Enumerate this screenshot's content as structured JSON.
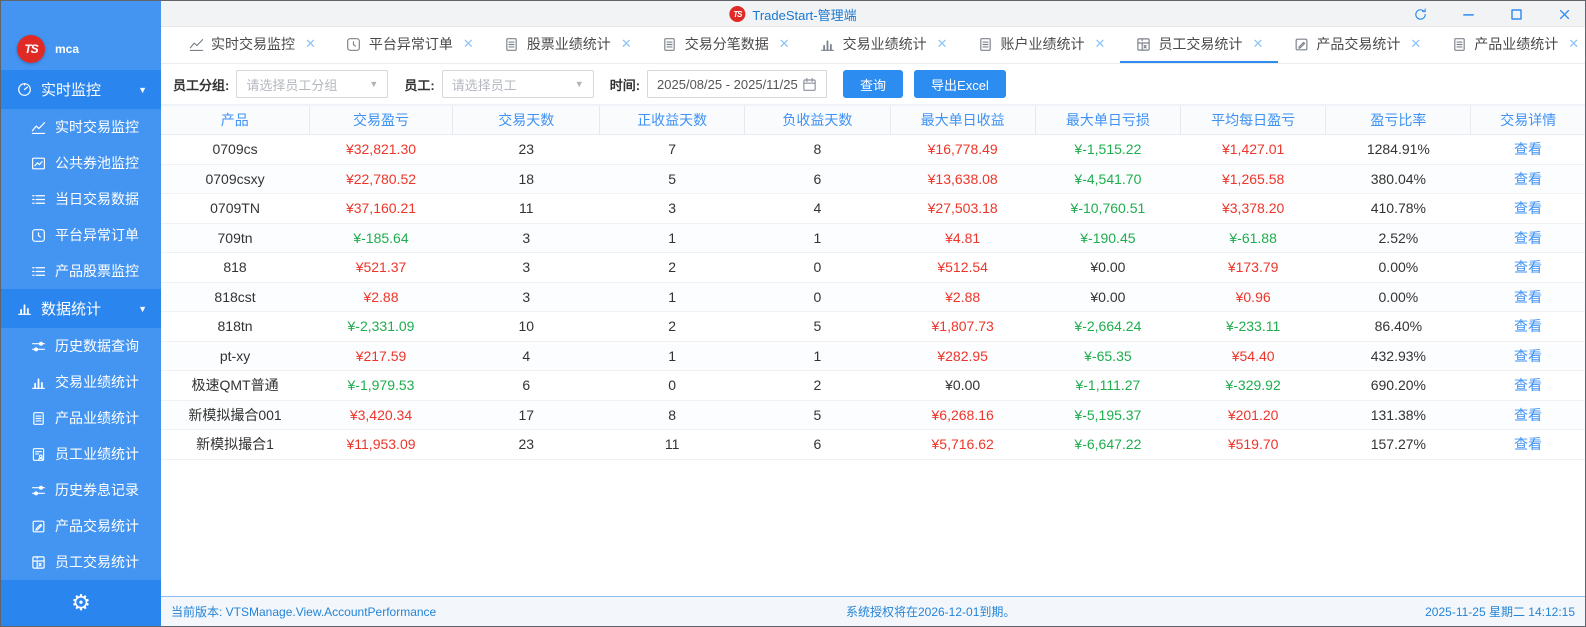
{
  "window": {
    "title": "TradeStart-管理端",
    "logo_text": "mca"
  },
  "titlebar": {
    "controls": [
      {
        "name": "refresh-button",
        "icon": "refresh-icon"
      },
      {
        "name": "minimize-button",
        "icon": "minimize-icon"
      },
      {
        "name": "maximize-button",
        "icon": "maximize-icon"
      },
      {
        "name": "close-button",
        "icon": "close-icon"
      }
    ]
  },
  "sidebar": {
    "groups": [
      {
        "label": "实时监控",
        "icon": "gauge-icon",
        "caret": "▼",
        "items": [
          {
            "label": "实时交易监控",
            "icon": "line-chart-icon"
          },
          {
            "label": "公共券池监控",
            "icon": "trend-box-icon"
          },
          {
            "label": "当日交易数据",
            "icon": "list-icon"
          },
          {
            "label": "平台异常订单",
            "icon": "clock-icon"
          },
          {
            "label": "产品股票监控",
            "icon": "list-icon"
          }
        ]
      },
      {
        "label": "数据统计",
        "icon": "bar-chart-icon",
        "caret": "▼",
        "items": [
          {
            "label": "历史数据查询",
            "icon": "sliders-icon"
          },
          {
            "label": "交易业绩统计",
            "icon": "bar-chart-icon"
          },
          {
            "label": "产品业绩统计",
            "icon": "doc-icon"
          },
          {
            "label": "员工业绩统计",
            "icon": "doc-person-icon"
          },
          {
            "label": "历史券息记录",
            "icon": "sliders-icon"
          },
          {
            "label": "产品交易统计",
            "icon": "edit-doc-icon"
          },
          {
            "label": "员工交易统计",
            "icon": "grid-doc-icon"
          }
        ]
      }
    ],
    "settings_icon": "gear-icon"
  },
  "tabs": [
    {
      "label": "实时交易监控",
      "icon": "line-chart-icon",
      "active": false
    },
    {
      "label": "平台异常订单",
      "icon": "clock-icon",
      "active": false
    },
    {
      "label": "股票业绩统计",
      "icon": "doc-icon",
      "active": false
    },
    {
      "label": "交易分笔数据",
      "icon": "doc-icon",
      "active": false
    },
    {
      "label": "交易业绩统计",
      "icon": "bar-chart-icon",
      "active": false
    },
    {
      "label": "账户业绩统计",
      "icon": "doc-icon",
      "active": false
    },
    {
      "label": "员工交易统计",
      "icon": "grid-doc-icon",
      "active": true
    },
    {
      "label": "产品交易统计",
      "icon": "edit-doc-icon",
      "active": false
    },
    {
      "label": "产品业绩统计",
      "icon": "doc-icon",
      "active": false
    }
  ],
  "filters": {
    "group_label": "员工分组:",
    "group_placeholder": "请选择员工分组",
    "employee_label": "员工:",
    "employee_placeholder": "请选择员工",
    "time_label": "时间:",
    "time_value": "2025/08/25 - 2025/11/25",
    "query_button": "查询",
    "export_button": "导出Excel"
  },
  "table": {
    "columns": [
      "产品",
      "交易盈亏",
      "交易天数",
      "正收益天数",
      "负收益天数",
      "最大单日收益",
      "最大单日亏损",
      "平均每日盈亏",
      "盈亏比率",
      "交易详情"
    ],
    "detail_link": "查看",
    "rows": [
      [
        "0709cs",
        "¥32,821.30",
        "23",
        "7",
        "8",
        "¥16,778.49",
        "¥-1,515.22",
        "¥1,427.01",
        "1284.91%"
      ],
      [
        "0709csxy",
        "¥22,780.52",
        "18",
        "5",
        "6",
        "¥13,638.08",
        "¥-4,541.70",
        "¥1,265.58",
        "380.04%"
      ],
      [
        "0709TN",
        "¥37,160.21",
        "11",
        "3",
        "4",
        "¥27,503.18",
        "¥-10,760.51",
        "¥3,378.20",
        "410.78%"
      ],
      [
        "709tn",
        "¥-185.64",
        "3",
        "1",
        "1",
        "¥4.81",
        "¥-190.45",
        "¥-61.88",
        "2.52%"
      ],
      [
        "818",
        "¥521.37",
        "3",
        "2",
        "0",
        "¥512.54",
        "¥0.00",
        "¥173.79",
        "0.00%"
      ],
      [
        "818cst",
        "¥2.88",
        "3",
        "1",
        "0",
        "¥2.88",
        "¥0.00",
        "¥0.96",
        "0.00%"
      ],
      [
        "818tn",
        "¥-2,331.09",
        "10",
        "2",
        "5",
        "¥1,807.73",
        "¥-2,664.24",
        "¥-233.11",
        "86.40%"
      ],
      [
        "pt-xy",
        "¥217.59",
        "4",
        "1",
        "1",
        "¥282.95",
        "¥-65.35",
        "¥54.40",
        "432.93%"
      ],
      [
        "极速QMT普通",
        "¥-1,979.53",
        "6",
        "0",
        "2",
        "¥0.00",
        "¥-1,111.27",
        "¥-329.92",
        "690.20%"
      ],
      [
        "新模拟撮合001",
        "¥3,420.34",
        "17",
        "8",
        "5",
        "¥6,268.16",
        "¥-5,195.37",
        "¥201.20",
        "131.38%"
      ],
      [
        "新模拟撮合1",
        "¥11,953.09",
        "23",
        "11",
        "6",
        "¥5,716.62",
        "¥-6,647.22",
        "¥519.70",
        "157.27%"
      ]
    ]
  },
  "statusbar": {
    "left": "当前版本: VTSManage.View.AccountPerformance",
    "center": "系统授权将在2026-12-01到期。",
    "right": "2025-11-25 星期二 14:12:15"
  },
  "colors": {
    "accent": "#2d8cf0",
    "profit_red": "#ee352a",
    "loss_green": "#1fad4e",
    "sidebar_blue": "#4495f2",
    "sidebar_header_blue": "#2b85ee",
    "link_blue": "#3f92f4"
  }
}
